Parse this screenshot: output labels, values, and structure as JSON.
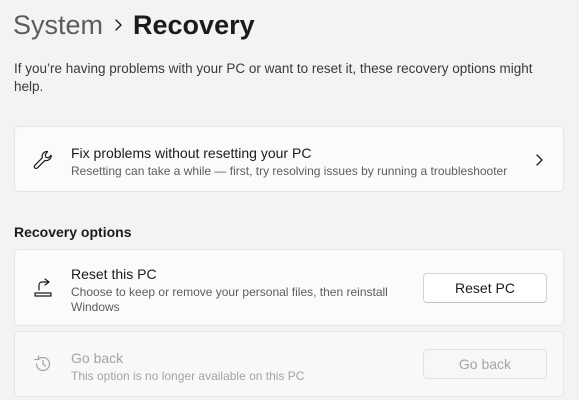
{
  "header": {
    "parent": "System",
    "current": "Recovery"
  },
  "intro_text": "If you’re having problems with your PC or want to reset it, these recovery options might help.",
  "fix_card": {
    "icon": "wrench-icon",
    "title": "Fix problems without resetting your PC",
    "description": "Resetting can take a while — first, try resolving issues by running a troubleshooter"
  },
  "recovery_options": {
    "heading": "Recovery options",
    "reset": {
      "icon": "reset-pc-icon",
      "title": "Reset this PC",
      "description": "Choose to keep or remove your personal files, then reinstall Windows",
      "button_label": "Reset PC"
    },
    "go_back": {
      "icon": "history-icon",
      "title": "Go back",
      "description": "This option is no longer available on this PC",
      "button_label": "Go back",
      "enabled": false
    }
  },
  "colors": {
    "background": "#f3f3f3",
    "card": "#fbfbfb",
    "text": "#1b1b1b",
    "secondary_text": "#5d5d5d",
    "disabled_text": "#a3a3a3"
  }
}
